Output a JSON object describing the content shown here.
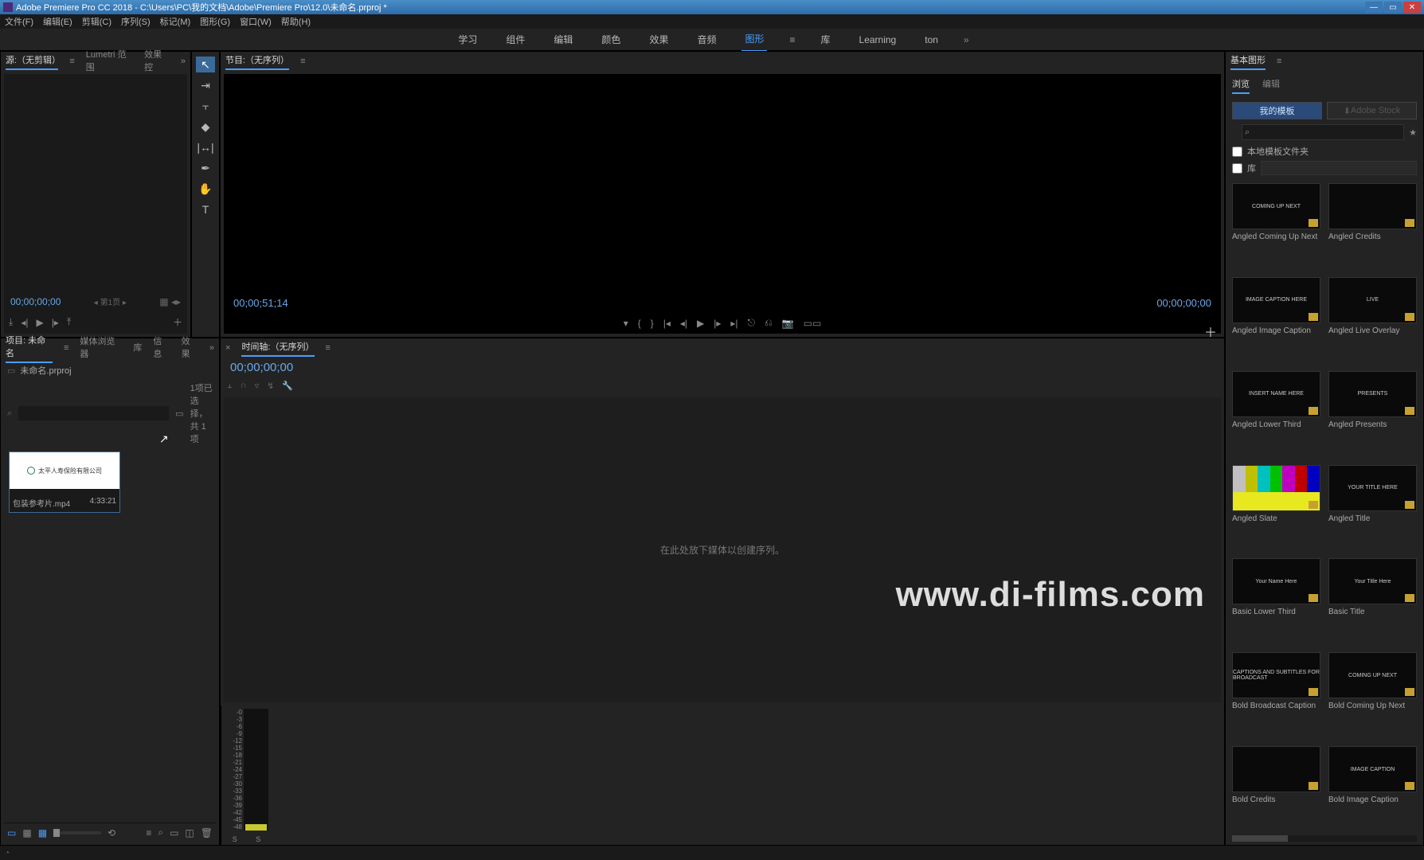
{
  "titlebar": {
    "title": "Adobe Premiere Pro CC 2018 - C:\\Users\\PC\\我的文档\\Adobe\\Premiere Pro\\12.0\\未命名.prproj *"
  },
  "menubar": {
    "file": "文件(F)",
    "edit": "编辑(E)",
    "clip": "剪辑(C)",
    "sequence": "序列(S)",
    "marker": "标记(M)",
    "graphics": "图形(G)",
    "window": "窗口(W)",
    "help": "帮助(H)"
  },
  "workspaces": {
    "learning_cn": "学习",
    "assembly": "组件",
    "editing": "编辑",
    "color": "颜色",
    "effects": "效果",
    "audio": "音频",
    "graphics": "图形",
    "library": "库",
    "learning_en": "Learning",
    "ton": "ton"
  },
  "source": {
    "tab_source": "源:（无剪辑）",
    "tab_lumetri": "Lumetri 范围",
    "tab_effects": "效果控",
    "tc_left": "00;00;00;00",
    "mid_label": "第1页"
  },
  "program": {
    "tab": "节目:（无序列）",
    "tc_left": "00;00;51;14",
    "tc_right": "00;00;00;00"
  },
  "graphics_panel": {
    "title": "基本图形",
    "tab_browse": "浏览",
    "tab_edit": "编辑",
    "my_templates": "我的模板",
    "adobe_stock": "Adobe Stock",
    "search_placeholder": "",
    "local_folder": "本地模板文件夹",
    "library": "库",
    "templates": [
      {
        "label": "Angled Coming Up Next",
        "text": "COMING UP NEXT"
      },
      {
        "label": "Angled Credits",
        "text": ""
      },
      {
        "label": "Angled Image Caption",
        "text": "IMAGE CAPTION HERE"
      },
      {
        "label": "Angled Live Overlay",
        "text": "LIVE"
      },
      {
        "label": "Angled Lower Third",
        "text": "INSERT NAME HERE"
      },
      {
        "label": "Angled Presents",
        "text": "PRESENTS"
      },
      {
        "label": "Angled Slate",
        "text": ""
      },
      {
        "label": "Angled Title",
        "text": "YOUR TITLE HERE"
      },
      {
        "label": "Basic Lower Third",
        "text": "Your Name Here"
      },
      {
        "label": "Basic Title",
        "text": "Your Title Here"
      },
      {
        "label": "Bold Broadcast Caption",
        "text": "CAPTIONS AND SUBTITLES FOR BROADCAST"
      },
      {
        "label": "Bold Coming Up Next",
        "text": "COMING UP NEXT"
      },
      {
        "label": "Bold Credits",
        "text": ""
      },
      {
        "label": "Bold Image Caption",
        "text": "IMAGE CAPTION"
      }
    ]
  },
  "project": {
    "tab_project": "项目: 未命名",
    "tab_media": "媒体浏览器",
    "tab_lib": "库",
    "tab_info": "信息",
    "tab_effects": "效果",
    "proj_name": "未命名.prproj",
    "selection_count": "1项已选择，共 1 项",
    "clip": {
      "name": "包装参考片.mp4",
      "duration": "4:33:21",
      "thumb_text": "太平人寿保险有限公司"
    }
  },
  "timeline": {
    "tab": "时间轴:（无序列）",
    "tc": "00;00;00;00",
    "empty_hint": "在此处放下媒体以创建序列。"
  },
  "audio_meter": {
    "ticks": [
      "-0",
      "-3",
      "-6",
      "-9",
      "-12",
      "-15",
      "-18",
      "-21",
      "-24",
      "-27",
      "-30",
      "-33",
      "-36",
      "-39",
      "-42",
      "-45",
      "-48"
    ],
    "solo": "S"
  },
  "watermark": "www.di-films.com"
}
